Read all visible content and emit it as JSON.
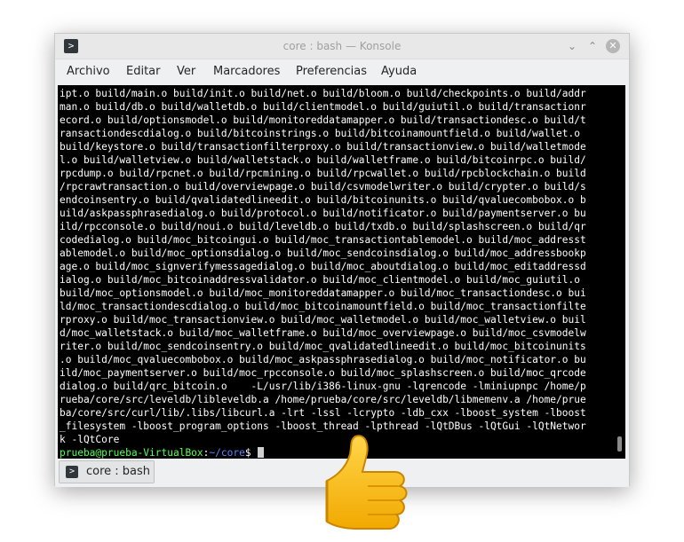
{
  "window": {
    "title": "core : bash — Konsole"
  },
  "menu": [
    {
      "label": "Archivo"
    },
    {
      "label": "Editar"
    },
    {
      "label": "Ver"
    },
    {
      "label": "Marcadores"
    },
    {
      "label": "Preferencias"
    },
    {
      "label": "Ayuda"
    }
  ],
  "terminal": {
    "lines": [
      "ipt.o build/main.o build/init.o build/net.o build/bloom.o build/checkpoints.o build/addr",
      "man.o build/db.o build/walletdb.o build/clientmodel.o build/guiutil.o build/transactionr",
      "ecord.o build/optionsmodel.o build/monitoreddatamapper.o build/transactiondesc.o build/t",
      "ransactiondescdialog.o build/bitcoinstrings.o build/bitcoinamountfield.o build/wallet.o",
      "build/keystore.o build/transactionfilterproxy.o build/transactionview.o build/walletmode",
      "l.o build/walletview.o build/walletstack.o build/walletframe.o build/bitcoinrpc.o build/",
      "rpcdump.o build/rpcnet.o build/rpcmining.o build/rpcwallet.o build/rpcblockchain.o build",
      "/rpcrawtransaction.o build/overviewpage.o build/csvmodelwriter.o build/crypter.o build/s",
      "endcoinsentry.o build/qvalidatedlineedit.o build/bitcoinunits.o build/qvaluecombobox.o b",
      "uild/askpassphrasedialog.o build/protocol.o build/notificator.o build/paymentserver.o bu",
      "ild/rpcconsole.o build/noui.o build/leveldb.o build/txdb.o build/splashscreen.o build/qr",
      "codedialog.o build/moc_bitcoingui.o build/moc_transactiontablemodel.o build/moc_addresst",
      "ablemodel.o build/moc_optionsdialog.o build/moc_sendcoinsdialog.o build/moc_addressbookp",
      "age.o build/moc_signverifymessagedialog.o build/moc_aboutdialog.o build/moc_editaddressd",
      "ialog.o build/moc_bitcoinaddressvalidator.o build/moc_clientmodel.o build/moc_guiutil.o",
      "build/moc_optionsmodel.o build/moc_monitoreddatamapper.o build/moc_transactiondesc.o bui",
      "ld/moc_transactiondescdialog.o build/moc_bitcoinamountfield.o build/moc_transactionfilte",
      "rproxy.o build/moc_transactionview.o build/moc_walletmodel.o build/moc_walletview.o buil",
      "d/moc_walletstack.o build/moc_walletframe.o build/moc_overviewpage.o build/moc_csvmodelw",
      "riter.o build/moc_sendcoinsentry.o build/moc_qvalidatedlineedit.o build/moc_bitcoinunits",
      ".o build/moc_qvaluecombobox.o build/moc_askpassphrasedialog.o build/moc_notificator.o bu",
      "ild/moc_paymentserver.o build/moc_rpcconsole.o build/moc_splashscreen.o build/moc_qrcode",
      "dialog.o build/qrc_bitcoin.o    -L/usr/lib/i386-linux-gnu -lqrencode -lminiupnpc /home/p",
      "rueba/core/src/leveldb/libleveldb.a /home/prueba/core/src/leveldb/libmemenv.a /home/prue",
      "ba/core/src/curl/lib/.libs/libcurl.a -lrt -lssl -lcrypto -ldb_cxx -lboost_system -lboost",
      "_filesystem -lboost_program_options -lboost_thread -lpthread -lQtDBus -lQtGui -lQtNetwor",
      "k -lQtCore"
    ],
    "prompt": {
      "user_host": "prueba@prueba-VirtualBox",
      "separator": ":",
      "path": "~/core",
      "symbol": "$ "
    }
  },
  "tab": {
    "label": "core : bash"
  },
  "icons": {
    "app": "terminal-icon",
    "minimize": "chevron-down-icon",
    "maximize": "chevron-up-icon",
    "close": "close-icon",
    "overlay": "thumbs-up-icon"
  },
  "colors": {
    "terminal_bg": "#000000",
    "terminal_fg": "#ffffff",
    "prompt_user": "#55ff55",
    "prompt_path": "#5b84ff",
    "thumb": "#f7b500"
  }
}
